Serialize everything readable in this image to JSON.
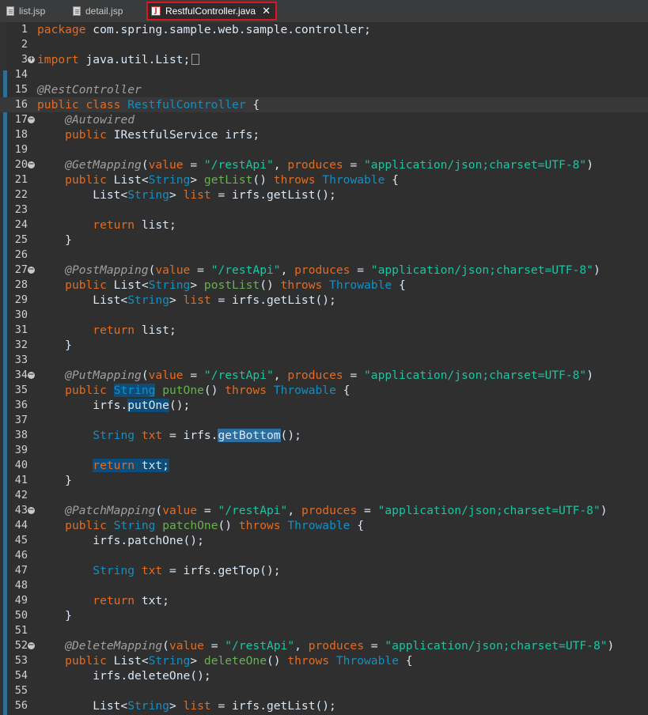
{
  "tabs": [
    {
      "label": "list.jsp",
      "active": false
    },
    {
      "label": "detail.jsp",
      "active": false
    },
    {
      "label": "RestfulController.java",
      "active": true
    }
  ],
  "close_glyph": "✕",
  "lines": [
    {
      "n": "1",
      "t": [
        [
          "kw",
          "package "
        ],
        [
          "",
          "com.spring.sample.web.sample.controller;"
        ]
      ]
    },
    {
      "n": "2",
      "t": []
    },
    {
      "n": "3",
      "fold": "+",
      "t": [
        [
          "kw",
          "import "
        ],
        [
          "",
          "java.util.List;"
        ]
      ],
      "folded": true
    },
    {
      "n": "14",
      "t": []
    },
    {
      "n": "15",
      "t": [
        [
          "ann",
          "@RestController"
        ]
      ]
    },
    {
      "n": "16",
      "cur": true,
      "t": [
        [
          "kw",
          "public class "
        ],
        [
          "ty",
          "RestfulController"
        ],
        [
          "",
          " {"
        ]
      ]
    },
    {
      "n": "17",
      "fold": "-",
      "t": [
        [
          "",
          "    "
        ],
        [
          "ann",
          "@Autowired"
        ]
      ]
    },
    {
      "n": "18",
      "t": [
        [
          "",
          "    "
        ],
        [
          "kw",
          "public "
        ],
        [
          "",
          "IRestfulService irfs;"
        ]
      ]
    },
    {
      "n": "19",
      "t": []
    },
    {
      "n": "20",
      "fold": "-",
      "t": [
        [
          "",
          "    "
        ],
        [
          "ann",
          "@GetMapping"
        ],
        [
          "",
          "("
        ],
        [
          "kw",
          "value"
        ],
        [
          "",
          " = "
        ],
        [
          "str",
          "\"/restApi\""
        ],
        [
          "",
          ", "
        ],
        [
          "kw",
          "produces"
        ],
        [
          "",
          " = "
        ],
        [
          "str",
          "\"application/json;charset=UTF-8\""
        ],
        [
          "",
          ")"
        ]
      ]
    },
    {
      "n": "21",
      "t": [
        [
          "",
          "    "
        ],
        [
          "kw",
          "public "
        ],
        [
          "",
          "List<"
        ],
        [
          "ty",
          "String"
        ],
        [
          "",
          "> "
        ],
        [
          "fn",
          "getList"
        ],
        [
          "",
          "() "
        ],
        [
          "kw",
          "throws "
        ],
        [
          "ty",
          "Throwable"
        ],
        [
          "",
          " {"
        ]
      ]
    },
    {
      "n": "22",
      "t": [
        [
          "",
          "        List<"
        ],
        [
          "ty",
          "String"
        ],
        [
          "",
          "> "
        ],
        [
          "kw",
          "list"
        ],
        [
          "",
          " = irfs.getList();"
        ]
      ]
    },
    {
      "n": "23",
      "t": []
    },
    {
      "n": "24",
      "t": [
        [
          "",
          "        "
        ],
        [
          "kw",
          "return "
        ],
        [
          "",
          "list;"
        ]
      ]
    },
    {
      "n": "25",
      "t": [
        [
          "",
          "    }"
        ]
      ]
    },
    {
      "n": "26",
      "t": []
    },
    {
      "n": "27",
      "fold": "-",
      "t": [
        [
          "",
          "    "
        ],
        [
          "ann",
          "@PostMapping"
        ],
        [
          "",
          "("
        ],
        [
          "kw",
          "value"
        ],
        [
          "",
          " = "
        ],
        [
          "str",
          "\"/restApi\""
        ],
        [
          "",
          ", "
        ],
        [
          "kw",
          "produces"
        ],
        [
          "",
          " = "
        ],
        [
          "str",
          "\"application/json;charset=UTF-8\""
        ],
        [
          "",
          ")"
        ]
      ]
    },
    {
      "n": "28",
      "t": [
        [
          "",
          "    "
        ],
        [
          "kw",
          "public "
        ],
        [
          "",
          "List<"
        ],
        [
          "ty",
          "String"
        ],
        [
          "",
          "> "
        ],
        [
          "fn",
          "postList"
        ],
        [
          "",
          "() "
        ],
        [
          "kw",
          "throws "
        ],
        [
          "ty",
          "Throwable"
        ],
        [
          "",
          " {"
        ]
      ]
    },
    {
      "n": "29",
      "t": [
        [
          "",
          "        List<"
        ],
        [
          "ty",
          "String"
        ],
        [
          "",
          "> "
        ],
        [
          "kw",
          "list"
        ],
        [
          "",
          " = irfs.getList();"
        ]
      ]
    },
    {
      "n": "30",
      "t": []
    },
    {
      "n": "31",
      "t": [
        [
          "",
          "        "
        ],
        [
          "kw",
          "return "
        ],
        [
          "",
          "list;"
        ]
      ]
    },
    {
      "n": "32",
      "t": [
        [
          "",
          "    }"
        ]
      ]
    },
    {
      "n": "33",
      "t": []
    },
    {
      "n": "34",
      "fold": "-",
      "t": [
        [
          "",
          "    "
        ],
        [
          "ann",
          "@PutMapping"
        ],
        [
          "",
          "("
        ],
        [
          "kw",
          "value"
        ],
        [
          "",
          " = "
        ],
        [
          "str",
          "\"/restApi\""
        ],
        [
          "",
          ", "
        ],
        [
          "kw",
          "produces"
        ],
        [
          "",
          " = "
        ],
        [
          "str",
          "\"application/json;charset=UTF-8\""
        ],
        [
          "",
          ")"
        ]
      ]
    },
    {
      "n": "35",
      "t": [
        [
          "",
          "    "
        ],
        [
          "kw",
          "public "
        ],
        [
          "ty hl",
          "String"
        ],
        [
          "",
          " "
        ],
        [
          "fn",
          "putOne"
        ],
        [
          "",
          "() "
        ],
        [
          "kw",
          "throws "
        ],
        [
          "ty",
          "Throwable"
        ],
        [
          "",
          " {"
        ]
      ]
    },
    {
      "n": "36",
      "t": [
        [
          "",
          "        irfs."
        ],
        [
          "hl",
          "putOne"
        ],
        [
          "",
          "();"
        ]
      ]
    },
    {
      "n": "37",
      "t": []
    },
    {
      "n": "38",
      "t": [
        [
          "",
          "        "
        ],
        [
          "ty",
          "String "
        ],
        [
          "kw",
          "txt"
        ],
        [
          "",
          " = irfs."
        ],
        [
          "hlb",
          "getBottom"
        ],
        [
          "",
          "();"
        ]
      ]
    },
    {
      "n": "39",
      "t": []
    },
    {
      "n": "40",
      "t": [
        [
          "",
          "        "
        ],
        [
          "kw hl",
          "return "
        ],
        [
          "hl",
          "txt;"
        ]
      ]
    },
    {
      "n": "41",
      "t": [
        [
          "",
          "    }"
        ]
      ]
    },
    {
      "n": "42",
      "t": []
    },
    {
      "n": "43",
      "fold": "-",
      "t": [
        [
          "",
          "    "
        ],
        [
          "ann",
          "@PatchMapping"
        ],
        [
          "",
          "("
        ],
        [
          "kw",
          "value"
        ],
        [
          "",
          " = "
        ],
        [
          "str",
          "\"/restApi\""
        ],
        [
          "",
          ", "
        ],
        [
          "kw",
          "produces"
        ],
        [
          "",
          " = "
        ],
        [
          "str",
          "\"application/json;charset=UTF-8\""
        ],
        [
          "",
          ")"
        ]
      ]
    },
    {
      "n": "44",
      "t": [
        [
          "",
          "    "
        ],
        [
          "kw",
          "public "
        ],
        [
          "ty",
          "String "
        ],
        [
          "fn",
          "patchOne"
        ],
        [
          "",
          "() "
        ],
        [
          "kw",
          "throws "
        ],
        [
          "ty",
          "Throwable"
        ],
        [
          "",
          " {"
        ]
      ]
    },
    {
      "n": "45",
      "t": [
        [
          "",
          "        irfs.patchOne();"
        ]
      ]
    },
    {
      "n": "46",
      "t": []
    },
    {
      "n": "47",
      "t": [
        [
          "",
          "        "
        ],
        [
          "ty",
          "String "
        ],
        [
          "kw",
          "txt"
        ],
        [
          "",
          " = irfs.getTop();"
        ]
      ]
    },
    {
      "n": "48",
      "t": []
    },
    {
      "n": "49",
      "t": [
        [
          "",
          "        "
        ],
        [
          "kw",
          "return "
        ],
        [
          "",
          "txt;"
        ]
      ]
    },
    {
      "n": "50",
      "t": [
        [
          "",
          "    }"
        ]
      ]
    },
    {
      "n": "51",
      "t": []
    },
    {
      "n": "52",
      "fold": "-",
      "t": [
        [
          "",
          "    "
        ],
        [
          "ann",
          "@DeleteMapping"
        ],
        [
          "",
          "("
        ],
        [
          "kw",
          "value"
        ],
        [
          "",
          " = "
        ],
        [
          "str",
          "\"/restApi\""
        ],
        [
          "",
          ", "
        ],
        [
          "kw",
          "produces"
        ],
        [
          "",
          " = "
        ],
        [
          "str",
          "\"application/json;charset=UTF-8\""
        ],
        [
          "",
          ")"
        ]
      ]
    },
    {
      "n": "53",
      "t": [
        [
          "",
          "    "
        ],
        [
          "kw",
          "public "
        ],
        [
          "",
          "List<"
        ],
        [
          "ty",
          "String"
        ],
        [
          "",
          "> "
        ],
        [
          "fn",
          "deleteOne"
        ],
        [
          "",
          "() "
        ],
        [
          "kw",
          "throws "
        ],
        [
          "ty",
          "Throwable"
        ],
        [
          "",
          " {"
        ]
      ]
    },
    {
      "n": "54",
      "t": [
        [
          "",
          "        irfs.deleteOne();"
        ]
      ]
    },
    {
      "n": "55",
      "t": []
    },
    {
      "n": "56",
      "t": [
        [
          "",
          "        List<"
        ],
        [
          "ty",
          "String"
        ],
        [
          "",
          "> "
        ],
        [
          "kw",
          "list"
        ],
        [
          "",
          " = irfs.getList();"
        ]
      ]
    }
  ],
  "colors": {
    "keyword": "#e56b1f",
    "annotation": "#a0a0a0",
    "type": "#1290c3",
    "string": "#17c6a3",
    "method": "#67b14f",
    "plain": "#d9e8f7",
    "background": "#2f2f2f",
    "active_tab_border": "#e0141e"
  }
}
